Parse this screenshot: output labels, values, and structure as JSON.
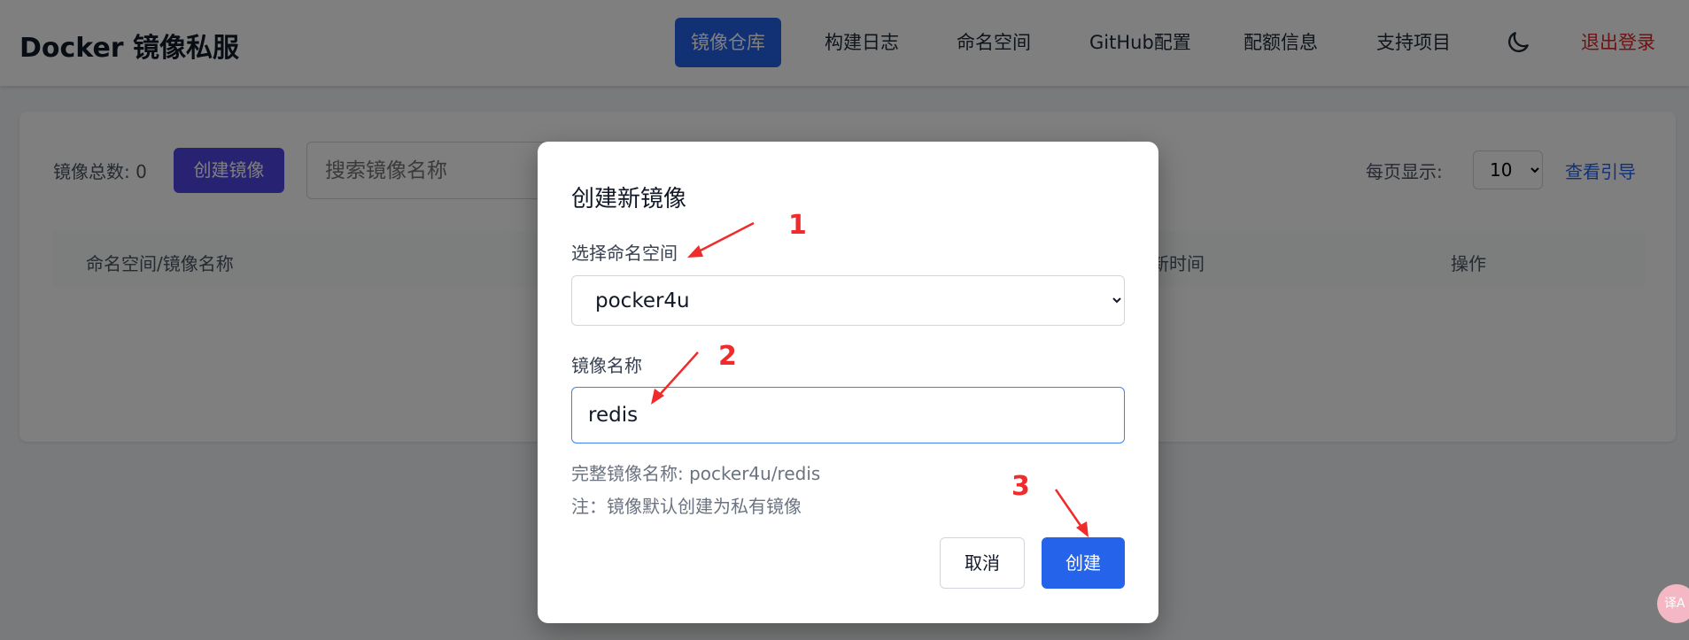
{
  "app": {
    "title": "Docker 镜像私服"
  },
  "nav": {
    "items": [
      "镜像仓库",
      "构建日志",
      "命名空间",
      "GitHub配置",
      "配额信息",
      "支持项目"
    ],
    "logout": "退出登录"
  },
  "toolbar": {
    "total_label": "镜像总数: 0",
    "create_label": "创建镜像",
    "search_placeholder": "搜索镜像名称",
    "per_page_label": "每页显示:",
    "per_page_value": "10",
    "guide_link": "查看引导"
  },
  "table": {
    "headers": [
      "命名空间/镜像名称",
      "更新时间",
      "操作"
    ]
  },
  "modal": {
    "title": "创建新镜像",
    "namespace_label": "选择命名空间",
    "namespace_value": "pocker4u",
    "name_label": "镜像名称",
    "name_value": "redis",
    "full_name_hint": "完整镜像名称: pocker4u/redis",
    "note": "注：镜像默认创建为私有镜像",
    "cancel_label": "取消",
    "create_label": "创建"
  },
  "annotations": {
    "step1": "1",
    "step2": "2",
    "step3": "3"
  },
  "colors": {
    "primary": "#2563eb",
    "indigo": "#4f46e5",
    "danger": "#dc2626",
    "annotation": "#ef2b2b"
  }
}
